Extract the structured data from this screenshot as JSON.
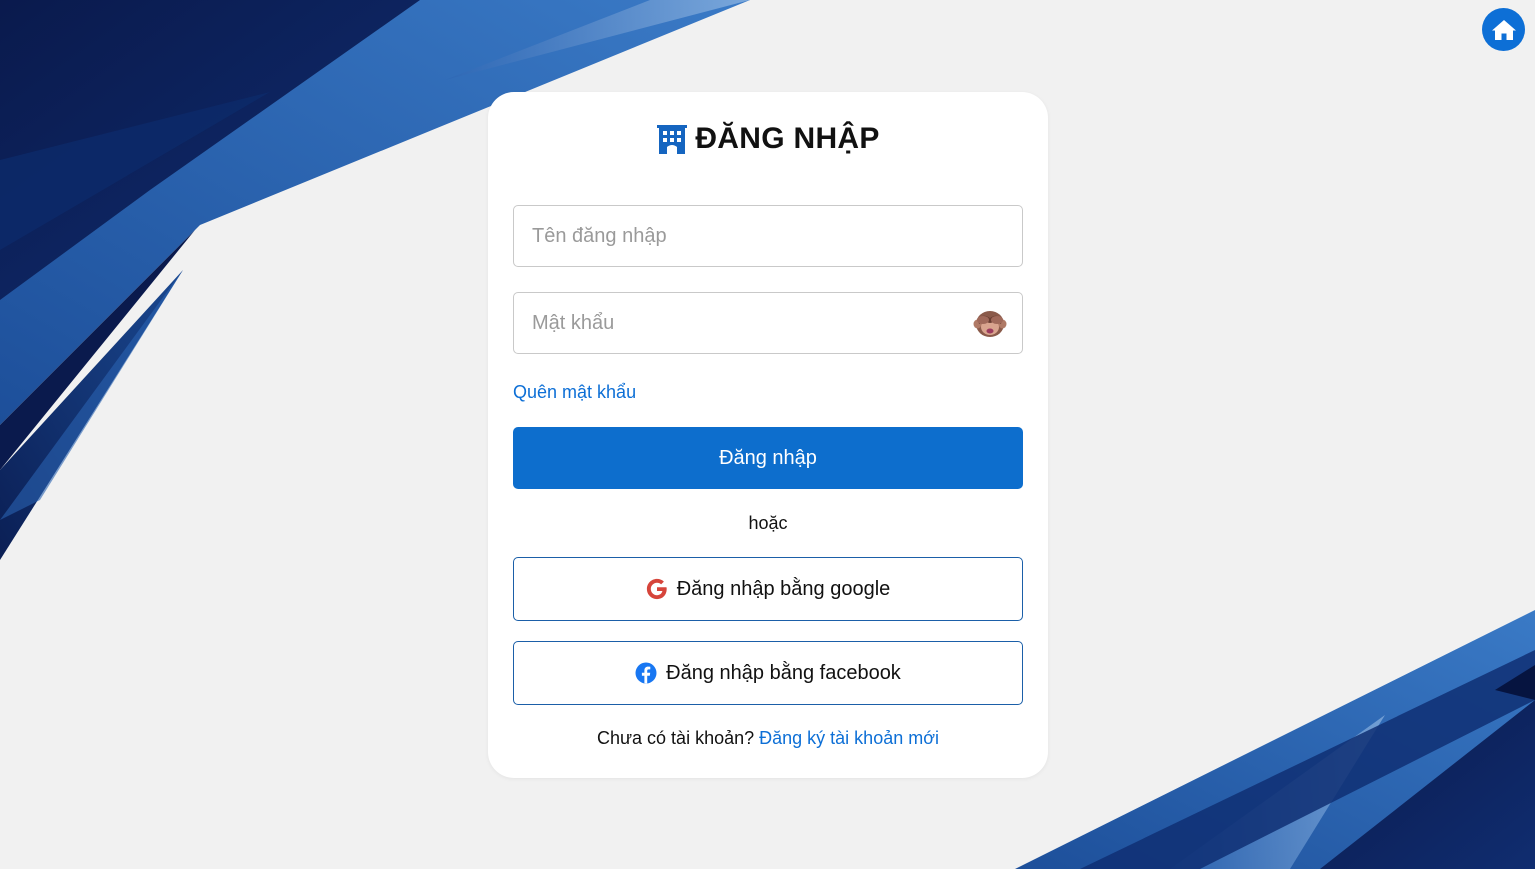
{
  "colors": {
    "primary": "#0d6ecd",
    "link": "#0d6fd6",
    "background": "#f1f1f1",
    "background_accent_dark": "#0a1f5c",
    "background_accent_light": "#3a78c4"
  },
  "nav": {
    "home_icon": "home-icon"
  },
  "login_form": {
    "title": "ĐĂNG NHẬP",
    "title_icon": "hotel-icon",
    "username": {
      "placeholder": "Tên đăng nhập",
      "value": ""
    },
    "password": {
      "placeholder": "Mật khẩu",
      "value": "",
      "toggle_icon": "see-no-evil-monkey-icon"
    },
    "forgot_password_label": "Quên mật khẩu",
    "submit_label": "Đăng nhập",
    "separator_label": "hoặc",
    "google_button": {
      "label": "Đăng nhập bằng google",
      "icon": "google-icon"
    },
    "facebook_button": {
      "label": "Đăng nhập bằng facebook",
      "icon": "facebook-icon"
    },
    "signup_prompt": "Chưa có tài khoản?",
    "signup_link_label": "Đăng ký tài khoản mới"
  }
}
